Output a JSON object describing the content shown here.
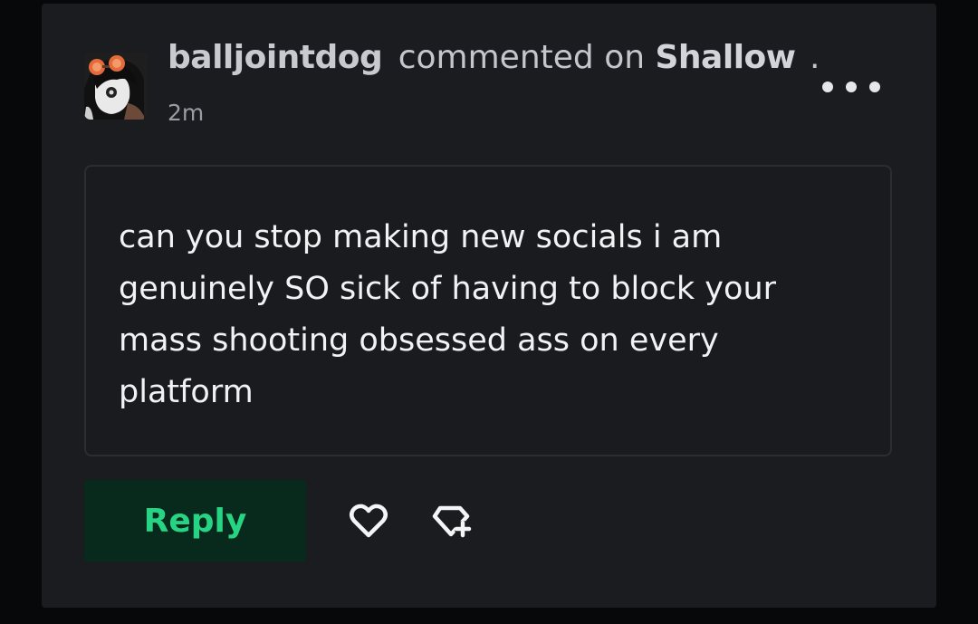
{
  "comment": {
    "username": "balljointdog",
    "action": "commented on",
    "target": "Shallow",
    "target_suffix": ".",
    "timestamp": "2m",
    "body": "can you stop making new socials i am genuinely SO sick of having to block your mass shooting obsessed ass on every platform"
  },
  "actions": {
    "reply_label": "Reply"
  },
  "icons": {
    "more": "more-horizontal-icon",
    "like": "heart-icon",
    "gift": "gem-plus-icon"
  },
  "colors": {
    "card_bg": "#1b1c20",
    "reply_bg": "#072a1c",
    "reply_text": "#27d483",
    "text_primary": "#f1f2f4",
    "text_secondary": "#9a9ca3"
  }
}
